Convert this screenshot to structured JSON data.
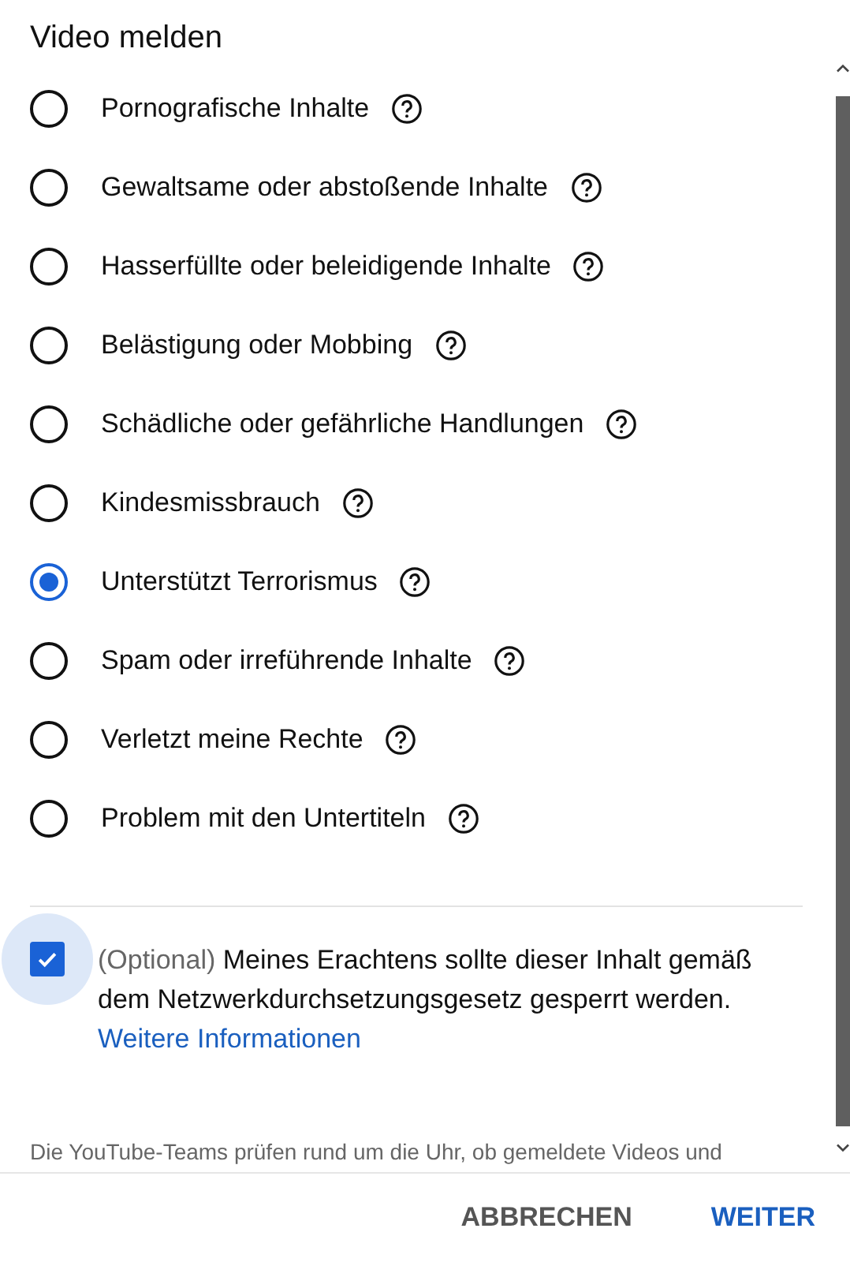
{
  "title": "Video melden",
  "options": [
    {
      "label": "Pornografische Inhalte",
      "selected": false
    },
    {
      "label": "Gewaltsame oder abstoßende Inhalte",
      "selected": false
    },
    {
      "label": "Hasserfüllte oder beleidigende Inhalte",
      "selected": false
    },
    {
      "label": "Belästigung oder Mobbing",
      "selected": false
    },
    {
      "label": "Schädliche oder gefährliche Handlungen",
      "selected": false
    },
    {
      "label": "Kindesmissbrauch",
      "selected": false
    },
    {
      "label": "Unterstützt Terrorismus",
      "selected": true
    },
    {
      "label": "Spam oder irreführende Inhalte",
      "selected": false
    },
    {
      "label": "Verletzt meine Rechte",
      "selected": false
    },
    {
      "label": "Problem mit den Untertiteln",
      "selected": false
    }
  ],
  "netzdg": {
    "checked": true,
    "prefix": "(Optional)",
    "text": "Meines Erachtens sollte dieser Inhalt gemäß dem Netzwerkdurchsetzungsgesetz gesperrt werden.",
    "link": "Weitere Informationen"
  },
  "footnote": "Die YouTube-Teams prüfen rund um die Uhr, ob gemeldete Videos und",
  "buttons": [
    {
      "label": "ABBRECHEN",
      "kind": "secondary"
    },
    {
      "label": "WEITER",
      "kind": "primary"
    }
  ]
}
